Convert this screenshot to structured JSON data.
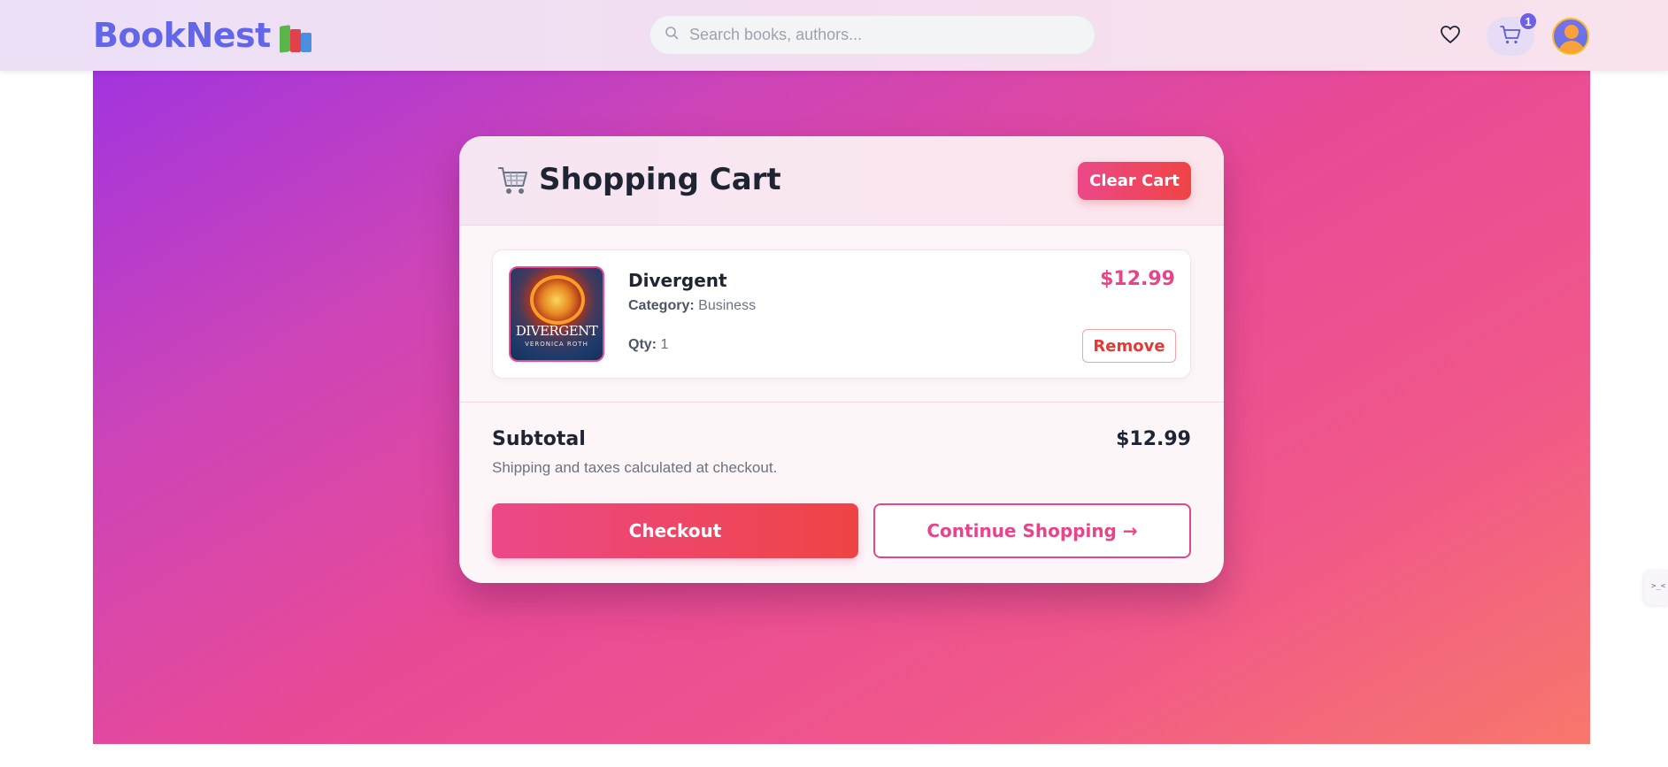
{
  "header": {
    "brand": "BookNest",
    "search_placeholder": "Search books, authors...",
    "cart_count": "1",
    "icons": [
      "books-icon",
      "search-icon",
      "heart-icon",
      "cart-icon",
      "avatar"
    ]
  },
  "cart": {
    "title": "Shopping Cart",
    "clear_label": "Clear Cart",
    "items": [
      {
        "title": "Divergent",
        "category_label": "Category:",
        "category": "Business",
        "qty_label": "Qty:",
        "qty": "1",
        "price": "$12.99",
        "remove_label": "Remove",
        "cover_title": "DIVERGENT",
        "cover_author": "VERONICA ROTH"
      }
    ],
    "subtotal_label": "Subtotal",
    "subtotal": "$12.99",
    "shipping_note": "Shipping and taxes calculated at checkout.",
    "checkout_label": "Checkout",
    "continue_label": "Continue Shopping →"
  },
  "side_tab_text": ">_<",
  "colors": {
    "brand": "#6366e8",
    "accent": "#e6458a",
    "danger": "#ef4444",
    "hero_start": "#a234de",
    "hero_end": "#f8776c"
  }
}
